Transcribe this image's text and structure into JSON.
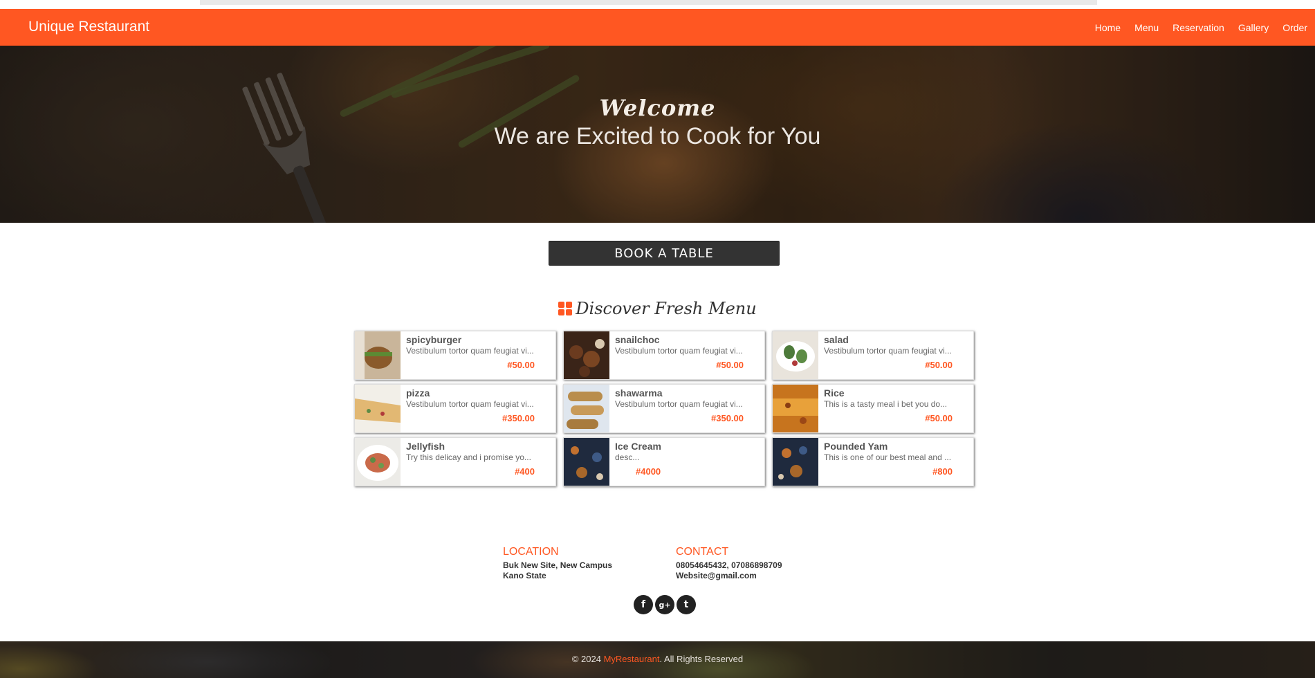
{
  "navbar": {
    "brand": "Unique Restaurant",
    "links": [
      "Home",
      "Menu",
      "Reservation",
      "Gallery",
      "Order"
    ],
    "color": "#ff5722"
  },
  "hero": {
    "welcome": "Welcome",
    "tagline": "We are Excited to Cook for You"
  },
  "book_button": "BOOK A TABLE",
  "menu_section": {
    "title": "Discover Fresh Menu",
    "icon": "grid-icon",
    "items": [
      {
        "name": "spicyburger",
        "desc": "Vestibulum tortor quam feugiat vi...",
        "price": "#50.00"
      },
      {
        "name": "snailchoc",
        "desc": "Vestibulum tortor quam feugiat vi...",
        "price": "#50.00"
      },
      {
        "name": "salad",
        "desc": "Vestibulum tortor quam feugiat vi...",
        "price": "#50.00"
      },
      {
        "name": "pizza",
        "desc": "Vestibulum tortor quam feugiat vi...",
        "price": "#350.00"
      },
      {
        "name": "shawarma",
        "desc": "Vestibulum tortor quam feugiat vi...",
        "price": "#350.00"
      },
      {
        "name": "Rice",
        "desc": "This is a tasty meal i bet you do...",
        "price": "#50.00"
      },
      {
        "name": "Jellyfish",
        "desc": "Try this delicay and i promise yo...",
        "price": "#400"
      },
      {
        "name": "Ice Cream",
        "desc": "desc...",
        "price": "#4000"
      },
      {
        "name": "Pounded Yam",
        "desc": "This is one of our best meal and ...",
        "price": "#800"
      }
    ]
  },
  "footer": {
    "location": {
      "heading": "LOCATION",
      "line1": "Buk New Site, New Campus",
      "line2": "Kano State"
    },
    "contact": {
      "heading": "CONTACT",
      "line1": "08054645432, 07086898709",
      "line2": "Website@gmail.com"
    },
    "social": [
      {
        "icon": "facebook-icon",
        "glyph": "f"
      },
      {
        "icon": "google-plus-icon",
        "glyph": "g+"
      },
      {
        "icon": "twitter-icon",
        "glyph": "t"
      }
    ]
  },
  "copyright": {
    "prefix": "© 2024 ",
    "brand": "MyRestaurant",
    "suffix": ". All Rights Reserved"
  }
}
